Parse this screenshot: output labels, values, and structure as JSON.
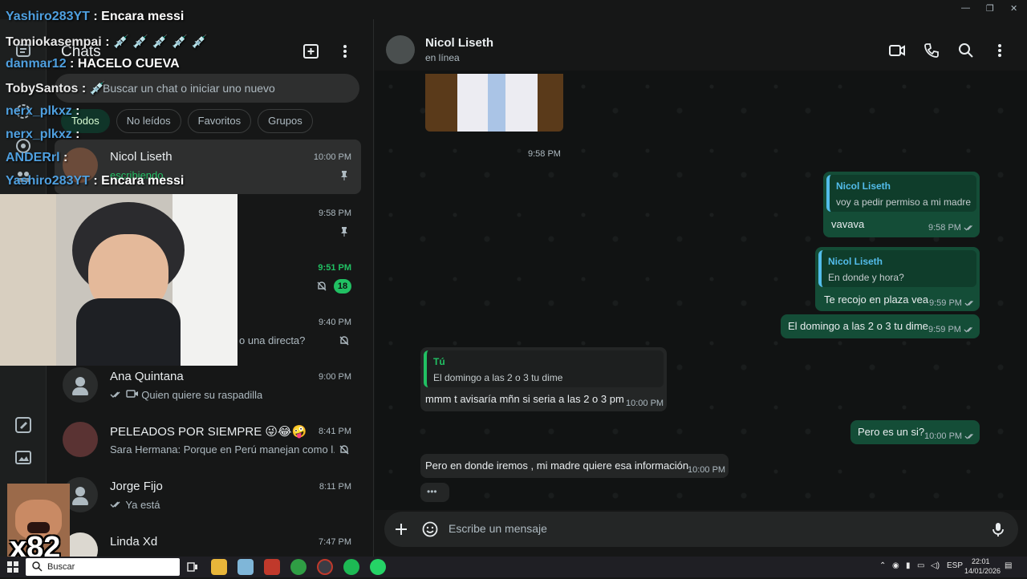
{
  "window": {
    "minimize": "—",
    "restore": "❐",
    "close": "✕"
  },
  "sidebar_panel": {
    "title": "Chats",
    "search_placeholder": "Buscar un chat o iniciar uno nuevo",
    "filters": [
      "Todos",
      "No leídos",
      "Favoritos",
      "Grupos"
    ],
    "chats": [
      {
        "name": "Nicol Liseth",
        "time": "10:00 PM",
        "preview": "escribiendo...",
        "pinned": true
      },
      {
        "name": "",
        "time": "9:58 PM",
        "preview": "",
        "pinned": true
      },
      {
        "name": "⚡⚡",
        "time": "9:51 PM",
        "preview": "",
        "unread": "18"
      },
      {
        "name": "",
        "time": "9:40 PM",
        "preview": "o una directa?"
      },
      {
        "name": "Ana Quintana",
        "time": "9:00 PM",
        "preview": "Quien quiere su raspadilla"
      },
      {
        "name": "PELEADOS POR SIEMPRE 😜😂🤪",
        "time": "8:41 PM",
        "preview": "Sara Hermana: Porque en Perú manejan como l..."
      },
      {
        "name": "Jorge Fijo",
        "time": "8:11 PM",
        "preview": "Ya está"
      },
      {
        "name": "Linda Xd",
        "time": "7:47 PM",
        "preview": ""
      }
    ]
  },
  "conversation": {
    "contact_name": "Nicol Liseth",
    "status": "en línea",
    "photo_time": "9:58 PM",
    "messages": [
      {
        "dir": "out",
        "quote_author": "Nicol Liseth",
        "quote_text": "voy a pedir permiso a mi madre",
        "text": "vavava",
        "time": "9:58 PM"
      },
      {
        "dir": "out",
        "quote_author": "Nicol Liseth",
        "quote_text": "En donde y hora?",
        "text": "Te recojo en plaza vea",
        "time": "9:59 PM"
      },
      {
        "dir": "out",
        "text": "El domingo a las 2 o 3 tu dime",
        "time": "9:59 PM"
      },
      {
        "dir": "in",
        "quote_author": "Tú",
        "quote_text": "El domingo a las 2 o 3 tu dime",
        "text": "mmm t avisaría mñn si seria a las 2 o 3 pm",
        "time": "10:00 PM"
      },
      {
        "dir": "out",
        "text": "Pero es un si?",
        "time": "10:00 PM"
      },
      {
        "dir": "in",
        "text": "Pero en donde iremos , mi madre quiere esa información",
        "time": "10:00 PM"
      },
      {
        "dir": "in",
        "text": "•••",
        "time": ""
      }
    ],
    "composer_placeholder": "Escribe un mensaje"
  },
  "overlay_chat": [
    {
      "user": "Yashiro283YT",
      "sep": " : ",
      "msg": "Encara messi"
    },
    {
      "user": "Tomiokasempai",
      "sep": " : ",
      "msg": "💉 💉 💉 💉 💉"
    },
    {
      "user": "danmar12",
      "sep": " : ",
      "msg": "HACELO CUEVA"
    },
    {
      "user": "TobySantos",
      "sep": " : ",
      "msg": "💉"
    },
    {
      "user": "nerx_plkxz",
      "sep": " : ",
      "msg": ""
    },
    {
      "user": "nerx_plkxz",
      "sep": " : ",
      "msg": ""
    },
    {
      "user": "ANDERrl",
      "sep": " : ",
      "msg": ""
    },
    {
      "user": "Yashiro283YT",
      "sep": " : ",
      "msg": "Encara messi"
    }
  ],
  "mini_overlay_label": "x82",
  "taskbar": {
    "search_text": "Buscar",
    "tray_lang": "ESP",
    "clock_time": "22:01",
    "clock_date": "14/01/2026"
  },
  "colors": {
    "accent_green": "#21c063",
    "outgoing_bubble": "#144d37",
    "incoming_bubble": "#242626",
    "quote_blue": "#53bdeb"
  }
}
